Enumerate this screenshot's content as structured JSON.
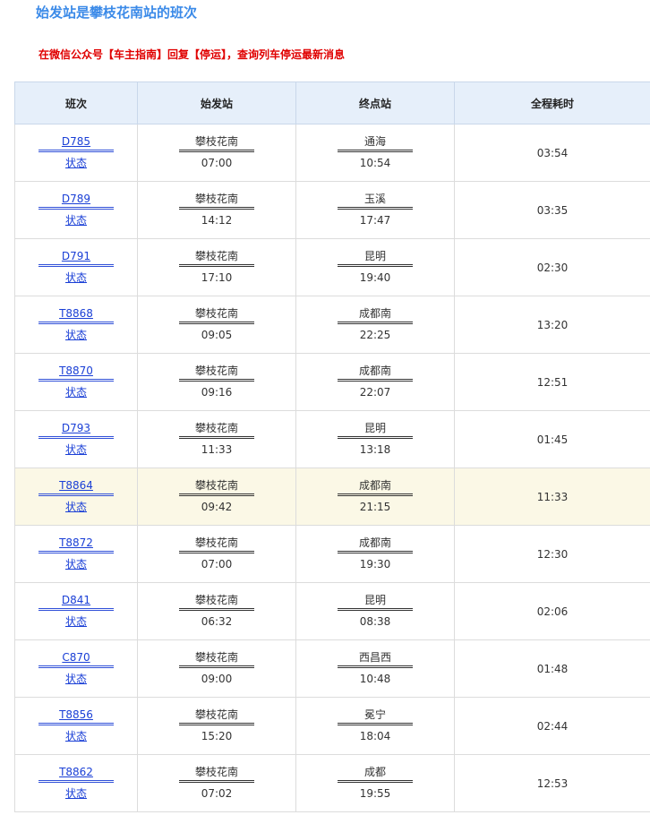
{
  "title": "始发站是攀枝花南站的班次",
  "notice": "在微信公众号【车主指南】回复【停运】，查询列车停运最新消息",
  "table": {
    "headers": [
      "班次",
      "始发站",
      "终点站",
      "全程耗时"
    ],
    "status_label": "状态",
    "rows": [
      {
        "train": "D785",
        "from": "攀枝花南",
        "dep": "07:00",
        "to": "通海",
        "arr": "10:54",
        "duration": "03:54"
      },
      {
        "train": "D789",
        "from": "攀枝花南",
        "dep": "14:12",
        "to": "玉溪",
        "arr": "17:47",
        "duration": "03:35"
      },
      {
        "train": "D791",
        "from": "攀枝花南",
        "dep": "17:10",
        "to": "昆明",
        "arr": "19:40",
        "duration": "02:30"
      },
      {
        "train": "T8868",
        "from": "攀枝花南",
        "dep": "09:05",
        "to": "成都南",
        "arr": "22:25",
        "duration": "13:20"
      },
      {
        "train": "T8870",
        "from": "攀枝花南",
        "dep": "09:16",
        "to": "成都南",
        "arr": "22:07",
        "duration": "12:51"
      },
      {
        "train": "D793",
        "from": "攀枝花南",
        "dep": "11:33",
        "to": "昆明",
        "arr": "13:18",
        "duration": "01:45"
      },
      {
        "train": "T8864",
        "from": "攀枝花南",
        "dep": "09:42",
        "to": "成都南",
        "arr": "21:15",
        "duration": "11:33"
      },
      {
        "train": "T8872",
        "from": "攀枝花南",
        "dep": "07:00",
        "to": "成都南",
        "arr": "19:30",
        "duration": "12:30"
      },
      {
        "train": "D841",
        "from": "攀枝花南",
        "dep": "06:32",
        "to": "昆明",
        "arr": "08:38",
        "duration": "02:06"
      },
      {
        "train": "C870",
        "from": "攀枝花南",
        "dep": "09:00",
        "to": "西昌西",
        "arr": "10:48",
        "duration": "01:48"
      },
      {
        "train": "T8856",
        "from": "攀枝花南",
        "dep": "15:20",
        "to": "冕宁",
        "arr": "18:04",
        "duration": "02:44"
      },
      {
        "train": "T8862",
        "from": "攀枝花南",
        "dep": "07:02",
        "to": "成都",
        "arr": "19:55",
        "duration": "12:53"
      }
    ],
    "highlight_row_index": 6
  },
  "colors": {
    "title": "#3b8ae8",
    "notice": "#e00000",
    "link": "#1a3fd6",
    "header_bg": "#e6effa",
    "highlight_bg": "#fbf8e6"
  }
}
